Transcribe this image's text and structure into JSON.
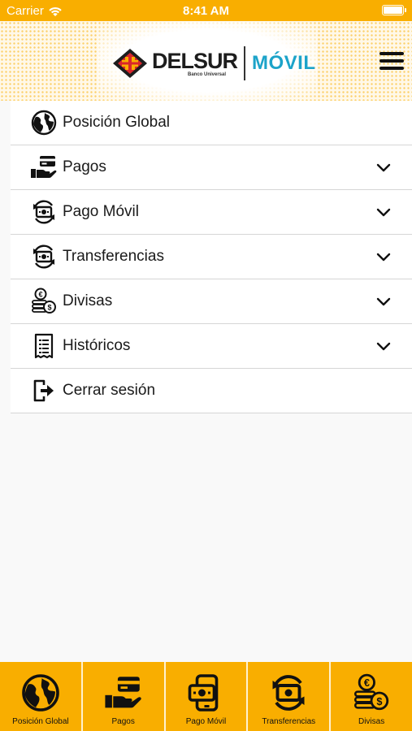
{
  "status_bar": {
    "carrier": "Carrier",
    "time": "8:41 AM"
  },
  "header": {
    "brand_name": "DELSUR",
    "brand_sub": "Banco Universal",
    "brand_movil": "MÓVIL"
  },
  "menu": {
    "items": [
      {
        "label": "Posición Global",
        "icon": "globe-icon",
        "expandable": false
      },
      {
        "label": "Pagos",
        "icon": "payment-hand-icon",
        "expandable": true
      },
      {
        "label": "Pago Móvil",
        "icon": "mobile-payment-icon",
        "expandable": true
      },
      {
        "label": "Transferencias",
        "icon": "transfer-icon",
        "expandable": true
      },
      {
        "label": "Divisas",
        "icon": "currency-coins-icon",
        "expandable": true
      },
      {
        "label": "Históricos",
        "icon": "receipt-icon",
        "expandable": true
      },
      {
        "label": "Cerrar sesión",
        "icon": "logout-icon",
        "expandable": false
      }
    ]
  },
  "tabbar": {
    "tabs": [
      {
        "label": "Posición Global",
        "icon": "globe-icon"
      },
      {
        "label": "Pagos",
        "icon": "payment-hand-icon"
      },
      {
        "label": "Pago Móvil",
        "icon": "mobile-payment-icon"
      },
      {
        "label": "Transferencias",
        "icon": "transfer-icon"
      },
      {
        "label": "Divisas",
        "icon": "currency-coins-icon"
      }
    ]
  },
  "colors": {
    "accent": "#f9ae00",
    "brand_movil": "#1ca3c9",
    "emblem_red": "#d9262c"
  }
}
